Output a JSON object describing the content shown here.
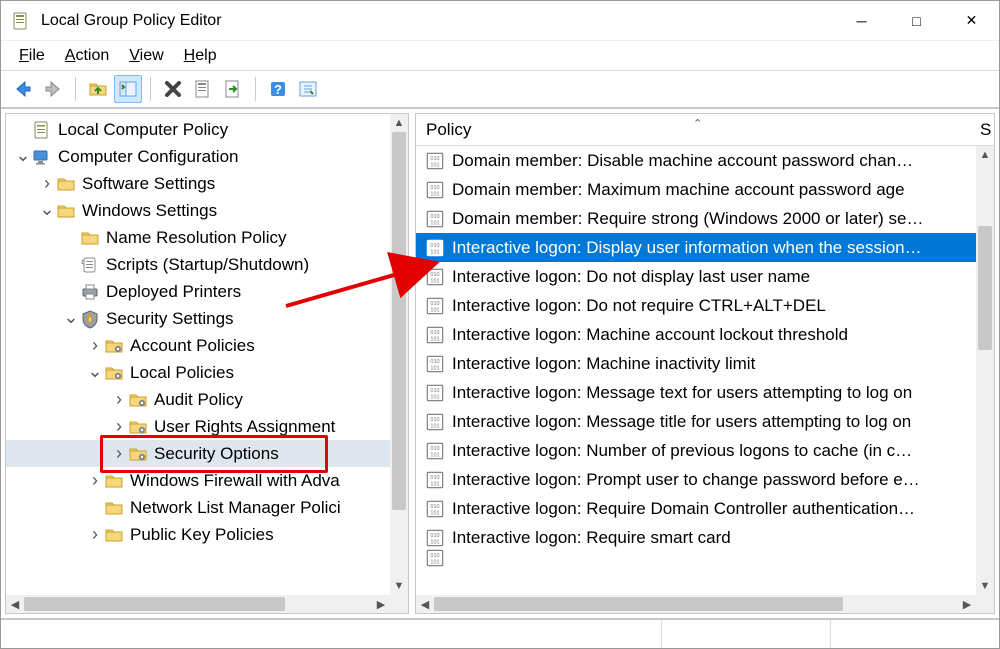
{
  "app": {
    "title": "Local Group Policy Editor"
  },
  "menu": {
    "file": "File",
    "action": "Action",
    "view": "View",
    "help": "Help"
  },
  "tree": {
    "root": "Local Computer Policy",
    "cc": "Computer Configuration",
    "ss": "Software Settings",
    "ws": "Windows Settings",
    "nrp": "Name Resolution Policy",
    "scripts": "Scripts (Startup/Shutdown)",
    "dp": "Deployed Printers",
    "sec": "Security Settings",
    "ap": "Account Policies",
    "lp": "Local Policies",
    "audit": "Audit Policy",
    "ura": "User Rights Assignment",
    "so": "Security Options",
    "wfw": "Windows Firewall with Adva",
    "nlm": "Network List Manager Polici",
    "pkp": "Public Key Policies"
  },
  "list_header": {
    "policy": "Policy",
    "security": "S"
  },
  "policies": [
    "Domain member: Disable machine account password chan…",
    "Domain member: Maximum machine account password age",
    "Domain member: Require strong (Windows 2000 or later) se…",
    "Interactive logon: Display user information when the session…",
    "Interactive logon: Do not display last user name",
    "Interactive logon: Do not require CTRL+ALT+DEL",
    "Interactive logon: Machine account lockout threshold",
    "Interactive logon: Machine inactivity limit",
    "Interactive logon: Message text for users attempting to log on",
    "Interactive logon: Message title for users attempting to log on",
    "Interactive logon: Number of previous logons to cache (in c…",
    "Interactive logon: Prompt user to change password before e…",
    "Interactive logon: Require Domain Controller authentication…",
    "Interactive logon: Require smart card"
  ],
  "selected_policy_index": 3
}
